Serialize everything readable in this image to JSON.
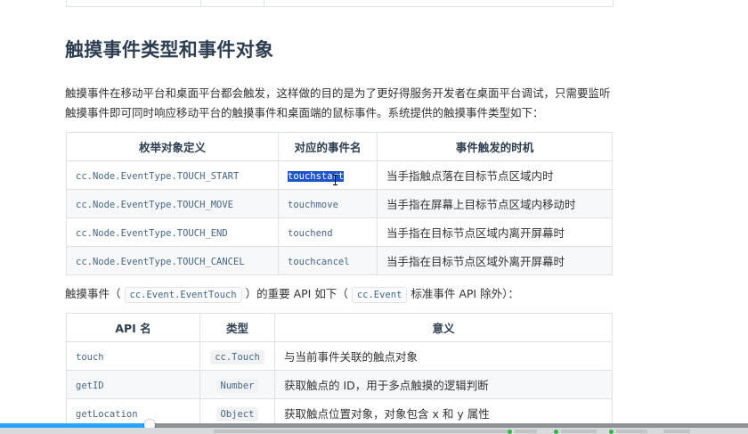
{
  "heading": "触摸事件类型和事件对象",
  "intro": "触摸事件在移动平台和桌面平台都会触发，这样做的目的是为了更好得服务开发者在桌面平台调试，只需要监听触摸事件即可同时响应移动平台的触摸事件和桌面端的鼠标事件。系统提供的触摸事件类型如下：",
  "event_table": {
    "headers": [
      "枚举对象定义",
      "对应的事件名",
      "事件触发的时机"
    ],
    "rows": [
      {
        "enum": "cc.Node.EventType.TOUCH_START",
        "name": "touchstart",
        "when": "当手指触点落在目标节点区域内时"
      },
      {
        "enum": "cc.Node.EventType.TOUCH_MOVE",
        "name": "touchmove",
        "when": "当手指在屏幕上目标节点区域内移动时"
      },
      {
        "enum": "cc.Node.EventType.TOUCH_END",
        "name": "touchend",
        "when": "当手指在目标节点区域内离开屏幕时"
      },
      {
        "enum": "cc.Node.EventType.TOUCH_CANCEL",
        "name": "touchcancel",
        "when": "当手指在目标节点区域外离开屏幕时"
      }
    ]
  },
  "api_line": {
    "prefix": "触摸事件（",
    "code1": "cc.Event.EventTouch",
    "middle": "）的重要 API 如下（",
    "code2": "cc.Event",
    "suffix": "标准事件 API 除外）："
  },
  "api_table": {
    "headers": [
      "API 名",
      "类型",
      "意义"
    ],
    "rows": [
      {
        "api": "touch",
        "type": "cc.Touch",
        "meaning": "与当前事件关联的触点对象"
      },
      {
        "api": "getID",
        "type": "Number",
        "meaning": "获取触点的 ID，用于多点触摸的逻辑判断"
      },
      {
        "api": "getLocation",
        "type": "Object",
        "meaning": "获取触点位置对象，对象包含 x 和 y 属性"
      }
    ]
  },
  "video_progress": 0.2
}
